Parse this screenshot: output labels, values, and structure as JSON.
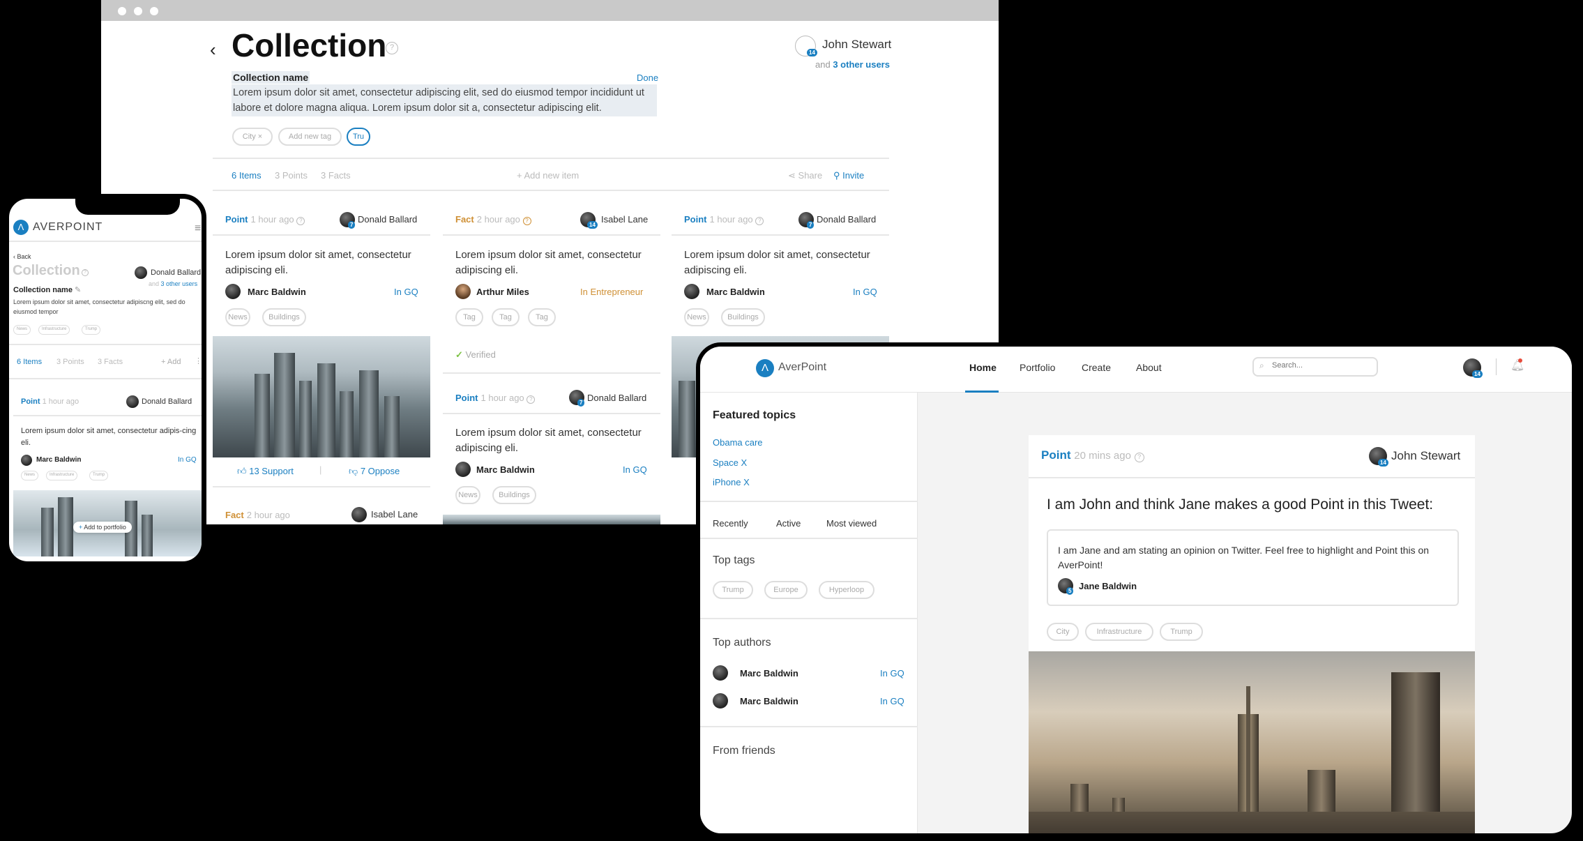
{
  "desktop": {
    "title": "Collection",
    "owner": "John Stewart",
    "owner_badge": "14",
    "others_prefix": "and",
    "others_link": "3 other users",
    "collection_name": "Collection name",
    "done": "Done",
    "description": "Lorem ipsum dolor sit amet, consectetur adipiscing elit, sed do eiusmod tempor incididunt ut labore et dolore magna aliqua. Lorem ipsum dolor sit a, consectetur adipiscing elit.",
    "tags": [
      "City ×",
      "Add new tag",
      "Tru"
    ],
    "tabs": {
      "items": "6 Items",
      "points": "3 Points",
      "facts": "3 Facts",
      "add": "+ Add new item",
      "share": "Share",
      "invite": "Invite"
    },
    "cards": [
      {
        "kind": "Point",
        "time": "1 hour ago",
        "user": "Donald Ballard",
        "text": "Lorem ipsum dolor sit amet, consectetur adipiscing eli.",
        "author": "Marc Baldwin",
        "in": "In GQ",
        "tags": [
          "News",
          "Buildings"
        ],
        "support": "13 Support",
        "oppose": "7 Oppose"
      },
      {
        "kind": "Fact",
        "time": "2 hour ago",
        "user": "Isabel Lane",
        "text": "Lorem ipsum dolor sit amet, consectetur adipiscing eli.",
        "author": "Arthur Miles",
        "in": "In Entrepreneur",
        "tags": [
          "Tag",
          "Tag",
          "Tag"
        ],
        "verified": "Verified"
      },
      {
        "kind": "Point",
        "time": "1 hour ago",
        "user": "Donald Ballard",
        "text": "Lorem ipsum dolor sit amet, consectetur adipiscing eli.",
        "author": "Marc Baldwin",
        "in": "In GQ",
        "tags": [
          "News",
          "Buildings"
        ]
      },
      {
        "kind": "Point",
        "time": "1 hour ago",
        "user": "Donald Ballard",
        "text": "Lorem ipsum dolor sit amet, consectetur adipiscing eli.",
        "author": "Marc Baldwin",
        "in": "In GQ",
        "tags": [
          "News",
          "Buildings"
        ]
      },
      {
        "kind": "Fact",
        "time": "2 hour ago",
        "user": "Isabel Lane"
      }
    ]
  },
  "phone": {
    "brand": "AVERPOINT",
    "back": "Back",
    "title": "Collection",
    "owner": "Donald Ballard",
    "others_prefix": "and",
    "others_link": "3 other users",
    "collection_name": "Collection name",
    "description": "Lorem ipsum dolor sit amet, consectetur adipiscng elit, sed do eiusmod tempor",
    "tags": [
      "News",
      "Infrastructure",
      "Trump"
    ],
    "tabs": {
      "items": "6 Items",
      "points": "3 Points",
      "facts": "3 Facts",
      "add": "+ Add"
    },
    "card": {
      "kind": "Point",
      "time": "1 hour ago",
      "user": "Donald Ballard",
      "text": "Lorem ipsum dolor sit amet, consectetur adipis-cing eli.",
      "author": "Marc Baldwin",
      "in": "In GQ",
      "tags": [
        "News",
        "Infrastructure",
        "Trump"
      ]
    },
    "add_portfolio": "Add to portfolio"
  },
  "tablet": {
    "brand": "AverPoint",
    "nav": [
      "Home",
      "Portfolio",
      "Create",
      "About"
    ],
    "search_placeholder": "Search...",
    "badge": "14",
    "featured_title": "Featured topics",
    "featured": [
      "Obama care",
      "Space X",
      "iPhone X"
    ],
    "filters": [
      "Recently",
      "Active",
      "Most viewed"
    ],
    "top_tags_title": "Top tags",
    "top_tags": [
      "Trump",
      "Europe",
      "Hyperloop"
    ],
    "top_authors_title": "Top authors",
    "authors": [
      {
        "name": "Marc Baldwin",
        "in": "In GQ"
      },
      {
        "name": "Marc Baldwin",
        "in": "In GQ"
      }
    ],
    "friends_title": "From friends",
    "post": {
      "kind": "Point",
      "time": "20 mins ago",
      "user": "John Stewart",
      "heading": "I am John and think Jane makes a good Point in this Tweet:",
      "quote": "I am Jane and am stating an opinion on Twitter. Feel free to highlight and Point this on AverPoint!",
      "quote_author": "Jane Baldwin",
      "tags": [
        "City",
        "Infrastructure",
        "Trump"
      ]
    }
  },
  "colors": {
    "accent": "#1a7fc1",
    "fact": "#cf9035",
    "verified": "#7cc243"
  }
}
